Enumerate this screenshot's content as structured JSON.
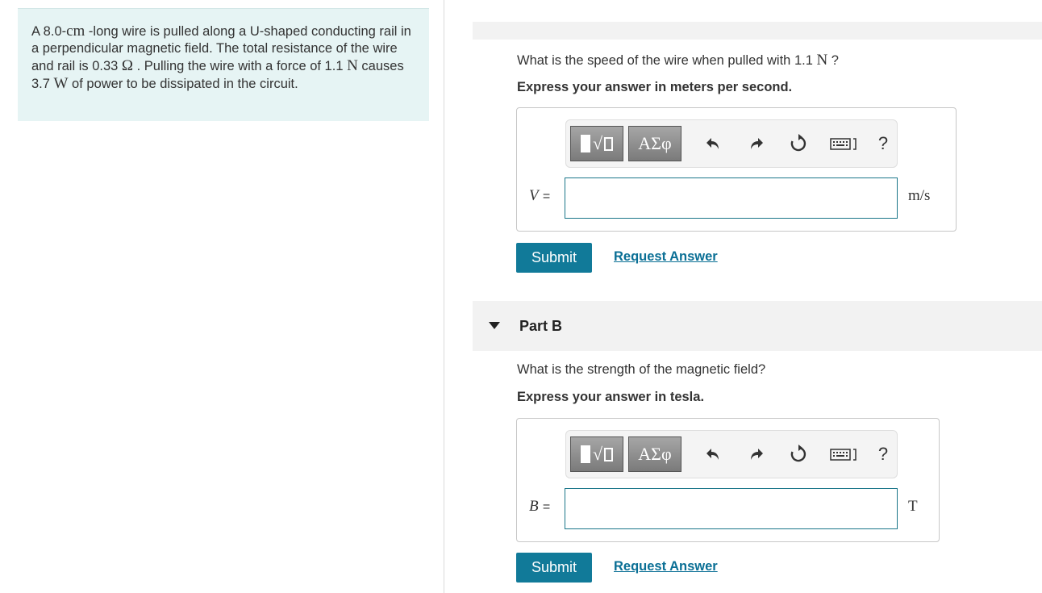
{
  "problem": {
    "p1": "A 8.0-",
    "p1_unit": "cm",
    "p2": " -long wire is pulled along a U-shaped conducting rail in a perpendicular magnetic field. The total resistance of the wire and rail is 0.33 ",
    "p2_unit": "Ω",
    "p3": " . Pulling the wire with a force of 1.1 ",
    "p3_unit": "N",
    "p4": " causes 3.7 ",
    "p4_unit": "W",
    "p5": " of power to be dissipated in the circuit."
  },
  "partA": {
    "question_pre": "What is the speed of the wire when pulled with 1.1 ",
    "question_unit": "N",
    "question_post": " ?",
    "instruction": "Express your answer in meters per second.",
    "variable": "V",
    "equals": "=",
    "input_value": "",
    "unit": "m/s",
    "submit_label": "Submit",
    "request_label": "Request Answer"
  },
  "partB": {
    "title": "Part B",
    "question": "What is the strength of the magnetic field?",
    "instruction": "Express your answer in tesla.",
    "variable": "B",
    "equals": "=",
    "input_value": "",
    "unit": "T",
    "submit_label": "Submit",
    "request_label": "Request Answer"
  },
  "toolbar": {
    "templates_icon": "templates-icon",
    "symbols_label": "ΑΣφ",
    "undo_icon": "undo-icon",
    "redo_icon": "redo-icon",
    "reset_icon": "reset-icon",
    "keyboard_icon": "keyboard-icon",
    "help_label": "?"
  },
  "colors": {
    "problem_bg": "#e6f4f4",
    "accent": "#117a99",
    "link": "#0a6f95",
    "input_border": "#1a7689"
  }
}
